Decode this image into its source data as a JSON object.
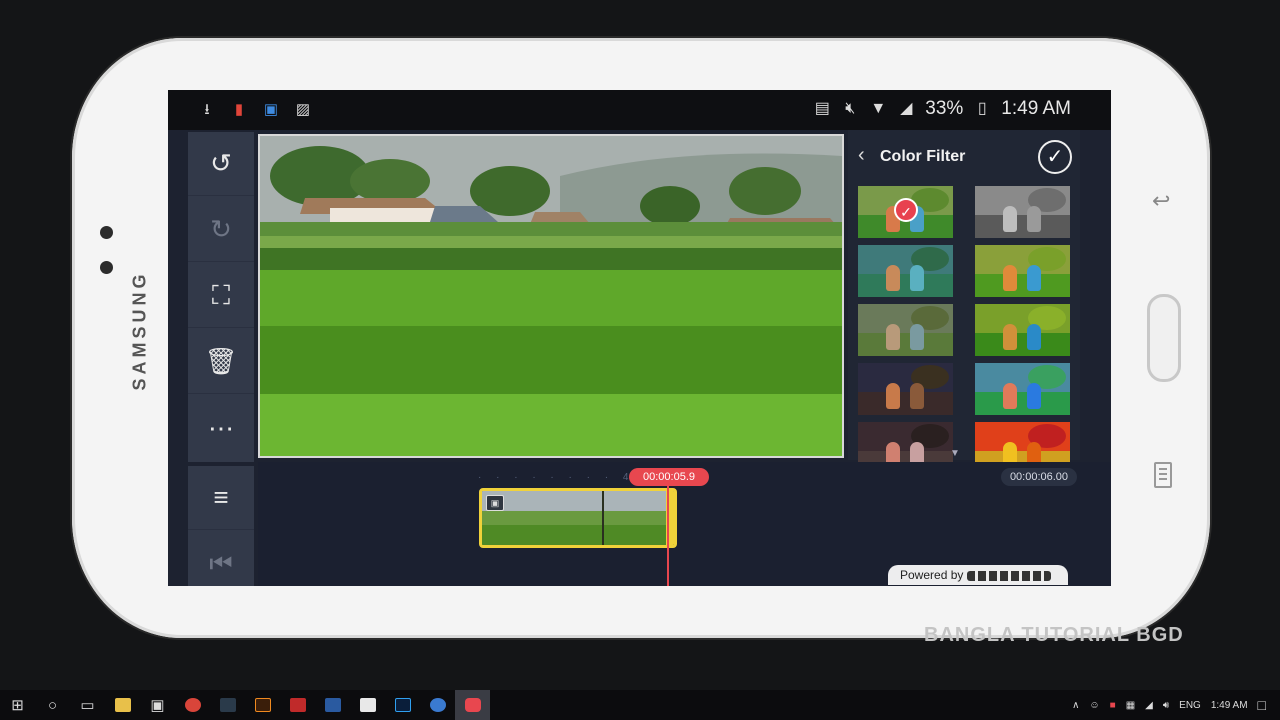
{
  "device": {
    "brand": "SAMSUNG"
  },
  "statusbar": {
    "left_icons": [
      "download-icon",
      "sd-card-icon",
      "store-bag-icon",
      "gallery-icon"
    ],
    "right_icons": [
      "cast-icon",
      "mute-icon",
      "wifi-icon",
      "signal-icon"
    ],
    "battery": "33%",
    "time": "1:49 AM"
  },
  "toolbar": {
    "items": [
      "undo-icon",
      "redo-icon",
      "fit-screen-icon",
      "delete-icon",
      "more-icon"
    ],
    "bottom_items": [
      "split-layer-icon",
      "skip-start-icon"
    ]
  },
  "filter_panel": {
    "title": "Color Filter",
    "selected_index": 0,
    "thumbs": [
      {
        "sky": "#7a9a4a",
        "ground": "#3f8a2a",
        "kid1": "#d87a4a",
        "kid2": "#4aa0c8",
        "tree": "#5d8a2f"
      },
      {
        "sky": "#8a8a8a",
        "ground": "#5a5a5a",
        "kid1": "#bdbdbd",
        "kid2": "#9a9a9a",
        "tree": "#6e6e6e"
      },
      {
        "sky": "#3f7a7a",
        "ground": "#2f7a5a",
        "kid1": "#c88a5a",
        "kid2": "#5ab0c0",
        "tree": "#2f6a4a"
      },
      {
        "sky": "#8aa03a",
        "ground": "#4f9a20",
        "kid1": "#e08a3a",
        "kid2": "#3a9ad0",
        "tree": "#7aa02a"
      },
      {
        "sky": "#6a7a5a",
        "ground": "#5a7a3a",
        "kid1": "#b89a7a",
        "kid2": "#7a9aa0",
        "tree": "#5a6a3a"
      },
      {
        "sky": "#7aa02a",
        "ground": "#3a8a1a",
        "kid1": "#d0903a",
        "kid2": "#2a8ac8",
        "tree": "#8ab02a"
      },
      {
        "sky": "#2a2a40",
        "ground": "#3a2a2a",
        "kid1": "#c87a4a",
        "kid2": "#8a5a3a",
        "tree": "#3a3020"
      },
      {
        "sky": "#4a8aa0",
        "ground": "#2a9a4a",
        "kid1": "#e07a5a",
        "kid2": "#2a7ae0",
        "tree": "#3aa060"
      },
      {
        "sky": "#3a2a30",
        "ground": "#4a3a3a",
        "kid1": "#d08070",
        "kid2": "#c8a0a0",
        "tree": "#2a2020"
      },
      {
        "sky": "#e0401a",
        "ground": "#d0a020",
        "kid1": "#f0c020",
        "kid2": "#e06010",
        "tree": "#c02020"
      }
    ]
  },
  "timeline": {
    "ruler_mark": "4",
    "current_time": "00:00:05.9",
    "total_time": "00:00:06.00",
    "powered_by": "Powered by"
  },
  "watermark": "BANGLA TUTORIAL BGD",
  "taskbar": {
    "language": "ENG",
    "time": "1:49 AM",
    "apps": [
      "windows-start",
      "search",
      "task-view",
      "file-explorer",
      "store",
      "chrome",
      "app-dark",
      "illustrator",
      "app-red",
      "word",
      "app-chat",
      "photoshop",
      "app-blue",
      "app-red-active"
    ]
  },
  "colors": {
    "accent_red": "#e8474f",
    "clip_yellow": "#f0d23a",
    "panel_bg": "#202634",
    "toolbar_bg": "#323949"
  }
}
